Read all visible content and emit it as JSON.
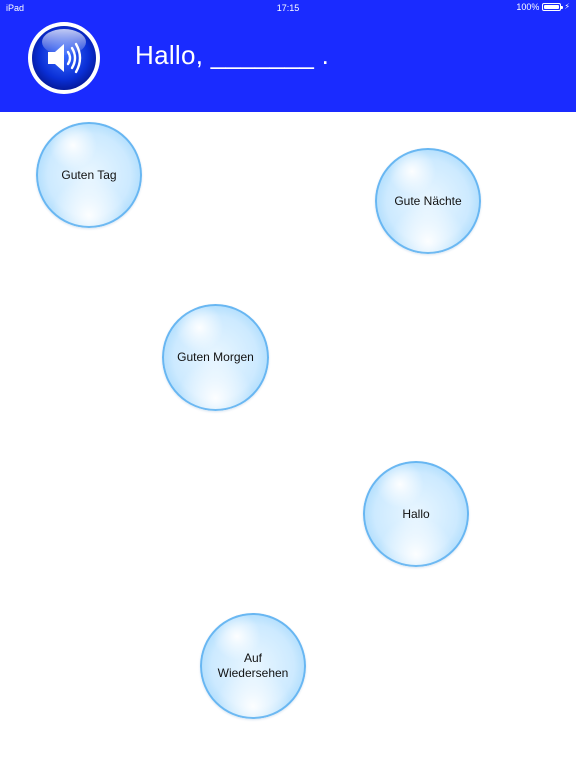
{
  "status_bar": {
    "device": "iPad",
    "time": "17:15",
    "battery": "100%",
    "battery_level": 1.0,
    "charging_icon": "lightning-bolt-icon"
  },
  "header": {
    "background": "#1a2bff",
    "speaker_icon": "speaker-icon",
    "prompt": "Hallo, _______ ."
  },
  "bubbles": [
    {
      "label": "Guten Tag"
    },
    {
      "label": "Gute Nächte"
    },
    {
      "label": "Guten Morgen"
    },
    {
      "label": "Hallo"
    },
    {
      "label": "Auf Wiedersehen"
    }
  ]
}
